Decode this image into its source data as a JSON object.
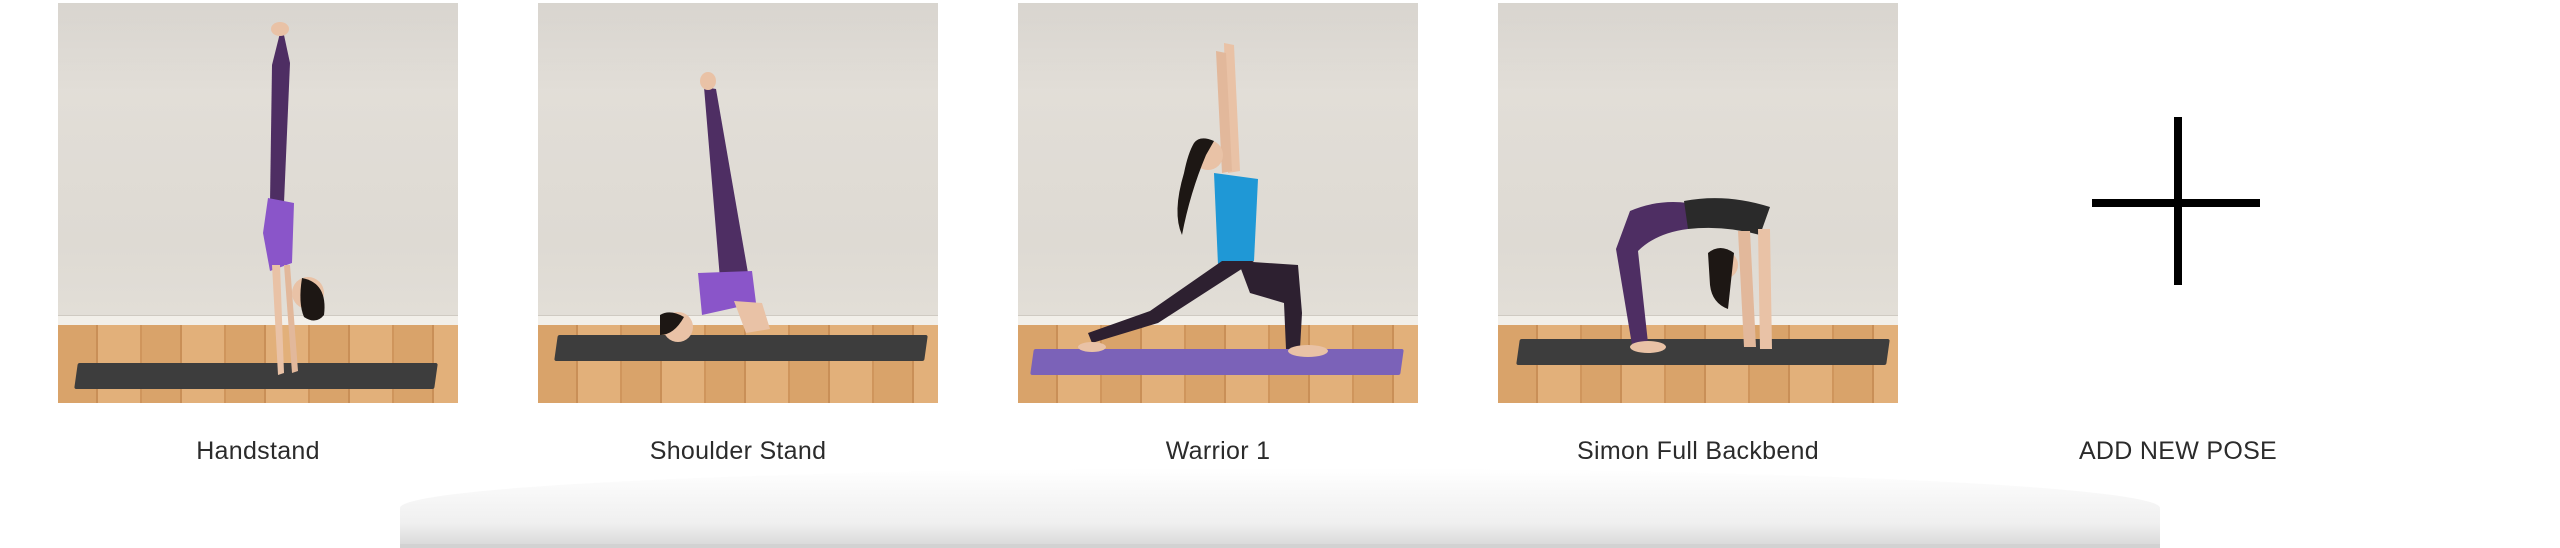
{
  "poses": [
    {
      "label": "Handstand",
      "mat_color": "#3d3d3d",
      "outfit_color": "#8a55c9"
    },
    {
      "label": "Shoulder Stand",
      "mat_color": "#3d3d3d",
      "outfit_color": "#8a55c9"
    },
    {
      "label": "Warrior 1",
      "mat_color": "#7b62b8",
      "outfit_color": "#1f98d6"
    },
    {
      "label": "Simon Full Backbend",
      "mat_color": "#3d3d3d",
      "outfit_color": "#2a2a2a"
    }
  ],
  "add_new": {
    "label": "ADD NEW POSE",
    "icon": "plus-icon"
  }
}
